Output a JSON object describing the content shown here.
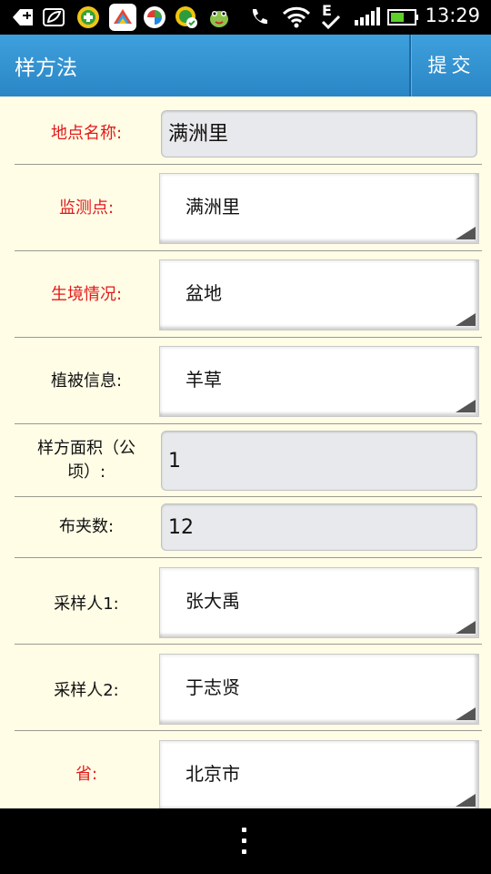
{
  "status_bar": {
    "time": "13:29",
    "network": "E",
    "icons": [
      "add-icon",
      "leaf-icon",
      "app-360-icon",
      "app-colorful-icon",
      "app-swirl-icon",
      "app-green-check-icon",
      "app-frog-icon",
      "phone-icon",
      "wifi-icon",
      "data-e-icon",
      "signal-icon",
      "battery-icon"
    ]
  },
  "header": {
    "title": "样方法",
    "submit_label": "提交"
  },
  "form": {
    "place_name": {
      "label": "地点名称:",
      "value": "满洲里",
      "required": true
    },
    "monitor_point": {
      "label": "监测点:",
      "value": "满洲里",
      "required": true
    },
    "habitat": {
      "label": "生境情况:",
      "value": "盆地",
      "required": true
    },
    "vegetation": {
      "label": "植被信息:",
      "value": "羊草",
      "required": false
    },
    "plot_area": {
      "label_line1": "样方面积（公",
      "label_line2": "顷）:",
      "value": "1",
      "required": false
    },
    "trap_count": {
      "label": "布夹数:",
      "value": "12",
      "required": false
    },
    "sampler1": {
      "label": "采样人1:",
      "value": "张大禹",
      "required": false
    },
    "sampler2": {
      "label": "采样人2:",
      "value": "于志贤",
      "required": false
    },
    "province": {
      "label": "省:",
      "value": "北京市",
      "required": true
    }
  },
  "colors": {
    "required_label": "#e11b1b",
    "header": "#2b86c6",
    "background": "#fffde6"
  }
}
